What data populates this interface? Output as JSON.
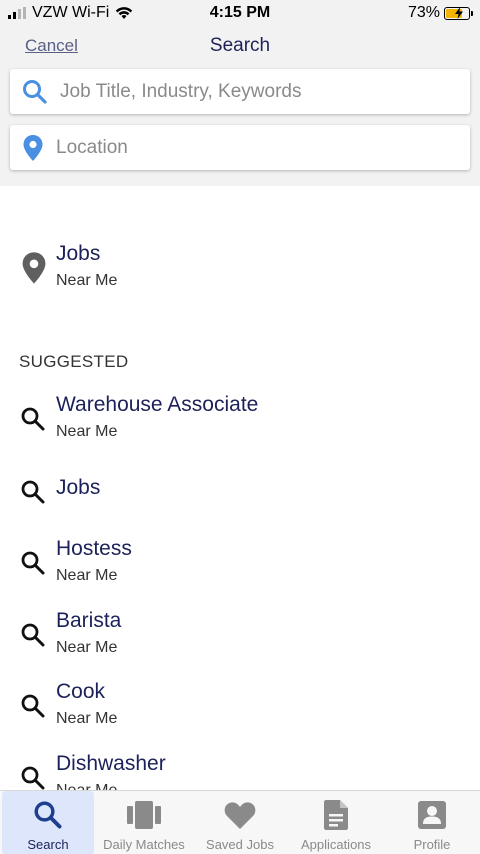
{
  "status": {
    "carrier": "VZW Wi-Fi",
    "time": "4:15 PM",
    "battery": "73%",
    "battery_level": 0.73
  },
  "header": {
    "cancel_label": "Cancel",
    "title": "Search",
    "keyword_placeholder": "Job Title, Industry, Keywords",
    "location_placeholder": "Location"
  },
  "nearby": {
    "title": "Jobs",
    "subtitle": "Near Me"
  },
  "suggested_label": "SUGGESTED",
  "suggestions": [
    {
      "title": "Warehouse Associate",
      "subtitle": "Near Me"
    },
    {
      "title": "Jobs",
      "subtitle": ""
    },
    {
      "title": "Hostess",
      "subtitle": "Near Me"
    },
    {
      "title": "Barista",
      "subtitle": "Near Me"
    },
    {
      "title": "Cook",
      "subtitle": "Near Me"
    },
    {
      "title": "Dishwasher",
      "subtitle": "Near Me"
    }
  ],
  "tabs": [
    {
      "label": "Search",
      "icon": "search-icon",
      "active": true
    },
    {
      "label": "Daily Matches",
      "icon": "cards-icon",
      "active": false
    },
    {
      "label": "Saved Jobs",
      "icon": "heart-icon",
      "active": false
    },
    {
      "label": "Applications",
      "icon": "document-icon",
      "active": false
    },
    {
      "label": "Profile",
      "icon": "profile-icon",
      "active": false
    }
  ],
  "colors": {
    "accent": "#4a90e2",
    "navy": "#1c2259",
    "tab_active_bg": "#dde6fa"
  }
}
